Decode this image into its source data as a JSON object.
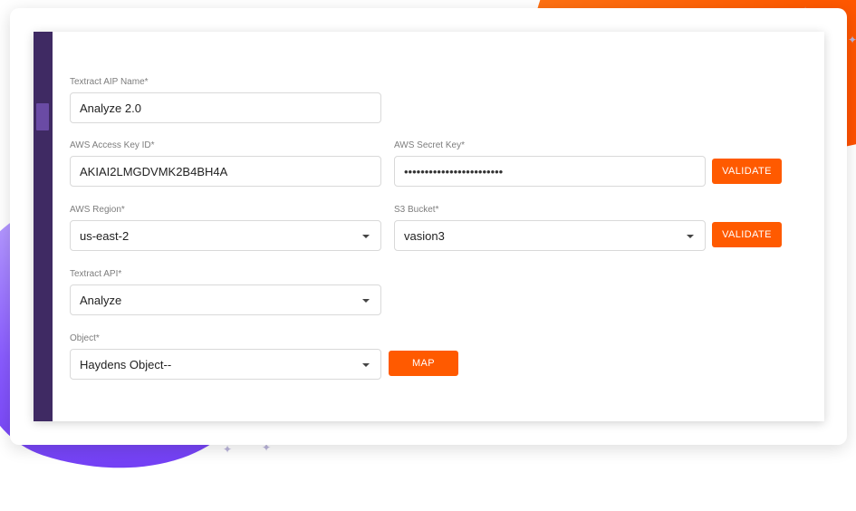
{
  "form": {
    "textract_name": {
      "label": "Textract AIP Name*",
      "value": "Analyze 2.0"
    },
    "access_key": {
      "label": "AWS Access Key ID*",
      "value": "AKIAI2LMGDVMK2B4BH4A"
    },
    "secret_key": {
      "label": "AWS Secret Key*",
      "value": "••••••••••••••••••••••••"
    },
    "region": {
      "label": "AWS Region*",
      "value": "us-east-2"
    },
    "bucket": {
      "label": "S3 Bucket*",
      "value": "vasion3"
    },
    "textract_api": {
      "label": "Textract API*",
      "value": "Analyze"
    },
    "object": {
      "label": "Object*",
      "value": "Haydens Object--"
    }
  },
  "buttons": {
    "validate_key": "VALIDATE",
    "validate_bucket": "VALIDATE",
    "map": "MAP"
  },
  "colors": {
    "accent": "#ff5a00",
    "sidebar": "#3f2a63",
    "sidebar_active": "#6a4ba5"
  }
}
